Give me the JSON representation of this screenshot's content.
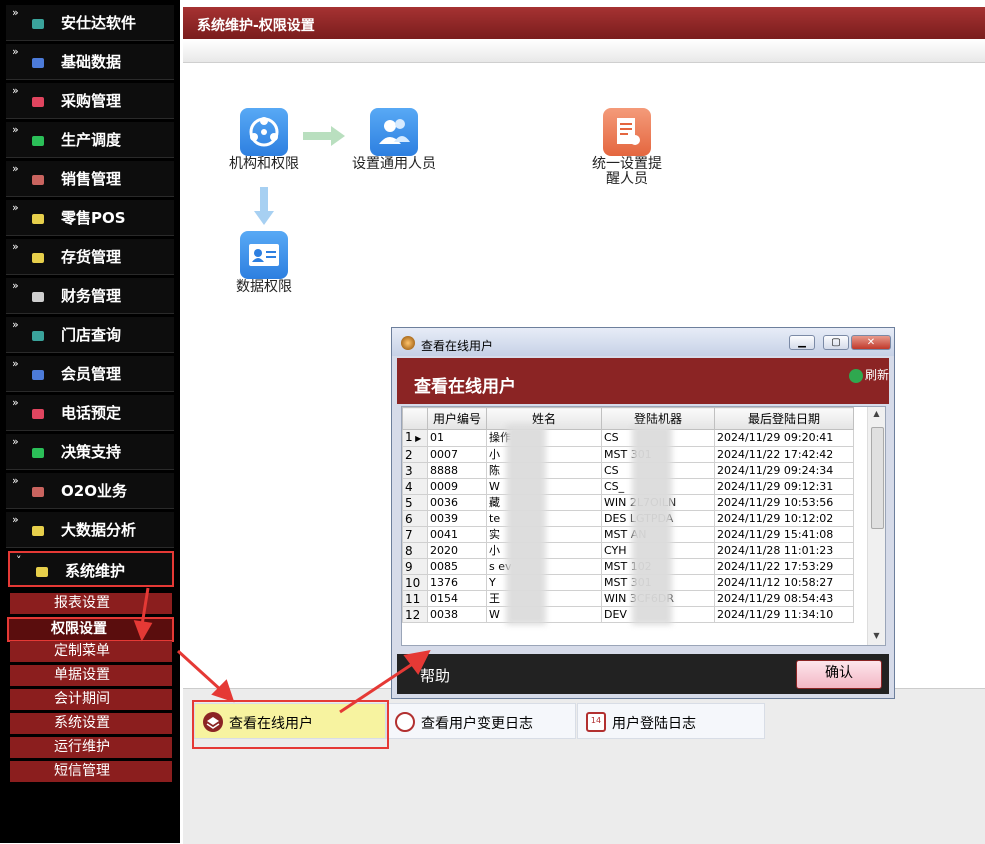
{
  "sidebar": {
    "items": [
      {
        "label": "安仕达软件",
        "color": "#3aa39b"
      },
      {
        "label": "基础数据",
        "color": "#4c7bd9"
      },
      {
        "label": "采购管理",
        "color": "#e0455f"
      },
      {
        "label": "生产调度",
        "color": "#2bbf58"
      },
      {
        "label": "销售管理",
        "color": "#c9645f"
      },
      {
        "label": "零售POS",
        "color": "#e6cf4b"
      },
      {
        "label": "存货管理",
        "color": "#e6cf4b"
      },
      {
        "label": "财务管理",
        "color": "#cfcfcf"
      },
      {
        "label": "门店查询",
        "color": "#3aa39b"
      },
      {
        "label": "会员管理",
        "color": "#4c7bd9"
      },
      {
        "label": "电话预定",
        "color": "#e0455f"
      },
      {
        "label": "决策支持",
        "color": "#2bbf58"
      },
      {
        "label": "O2O业务",
        "color": "#c9645f"
      },
      {
        "label": "大数据分析",
        "color": "#e6cf4b"
      },
      {
        "label": "系统维护",
        "color": "#e6cf4b"
      }
    ],
    "subitems": [
      "报表设置",
      "权限设置",
      "定制菜单",
      "单据设置",
      "会计期间",
      "系统设置",
      "运行维护",
      "短信管理"
    ]
  },
  "header": {
    "title": "系统维护-权限设置"
  },
  "flow": {
    "org": "机构和权限",
    "users": "设置通用人员",
    "reminder": "统一设置提醒人员",
    "data": "数据权限"
  },
  "bottom_tabs": [
    "查看在线用户",
    "查看用户变更日志",
    "用户登陆日志"
  ],
  "dialog": {
    "window_title": "查看在线用户",
    "header": "查看在线用户",
    "refresh": "刷新",
    "columns": [
      "用户编号",
      "姓名",
      "登陆机器",
      "最后登陆日期"
    ],
    "rows": [
      {
        "n": "1",
        "id": "01",
        "name": "操作",
        "machine": "CS",
        "date": "2024/11/29 09:20:41"
      },
      {
        "n": "2",
        "id": "0007",
        "name": "小",
        "machine": "MST        301",
        "date": "2024/11/22 17:42:42"
      },
      {
        "n": "3",
        "id": "8888",
        "name": "陈",
        "machine": "CS",
        "date": "2024/11/29 09:24:34"
      },
      {
        "n": "4",
        "id": "0009",
        "name": "W",
        "machine": "CS_",
        "date": "2024/11/29 09:12:31"
      },
      {
        "n": "5",
        "id": "0036",
        "name": "藏",
        "machine": "WIN       2L7OILN",
        "date": "2024/11/29 10:53:56"
      },
      {
        "n": "6",
        "id": "0039",
        "name": "te",
        "machine": "DES       LGTPDA",
        "date": "2024/11/29 10:12:02"
      },
      {
        "n": "7",
        "id": "0041",
        "name": "实",
        "machine": "MST        AN",
        "date": "2024/11/29 15:41:08"
      },
      {
        "n": "8",
        "id": "2020",
        "name": "小",
        "machine": "CYH",
        "date": "2024/11/28 11:01:23"
      },
      {
        "n": "9",
        "id": "0085",
        "name": "s        ev",
        "machine": "MST        102",
        "date": "2024/11/22 17:53:29"
      },
      {
        "n": "10",
        "id": "1376",
        "name": "Y",
        "machine": "MST        301",
        "date": "2024/11/12 10:58:27"
      },
      {
        "n": "11",
        "id": "0154",
        "name": "王",
        "machine": "WIN        3CF6DR",
        "date": "2024/11/29 08:54:43"
      },
      {
        "n": "12",
        "id": "0038",
        "name": "W",
        "machine": "DEV",
        "date": "2024/11/29 11:34:10"
      }
    ],
    "help": "帮助",
    "ok": "确认"
  },
  "colors": {
    "brand": "#8b2424",
    "highlight": "#f7f3a0",
    "annotation": "#e53935"
  }
}
